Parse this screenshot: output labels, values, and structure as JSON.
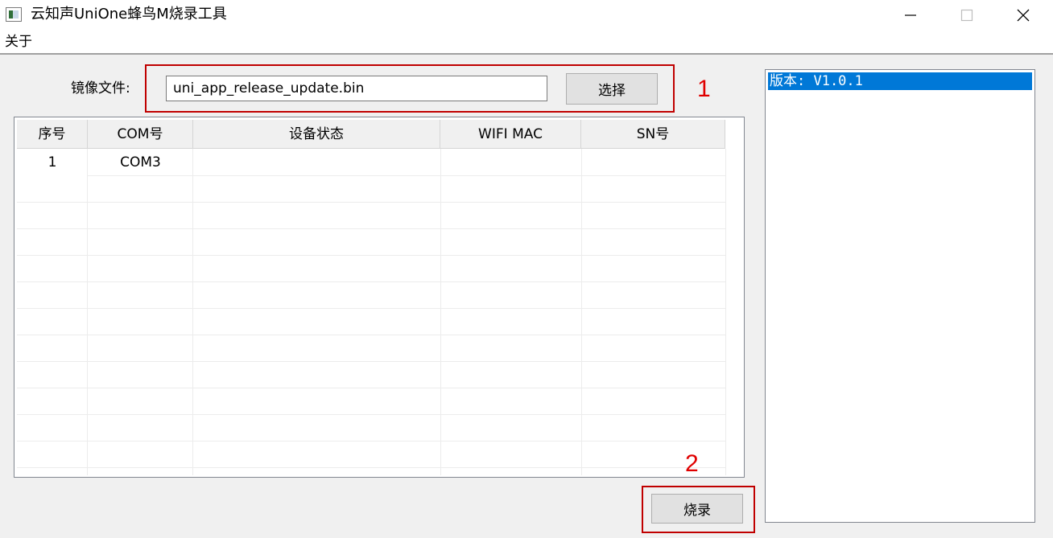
{
  "window": {
    "title": "云知声UniOne蜂鸟M烧录工具",
    "minimize_icon": "minimize-icon",
    "maximize_icon": "maximize-icon",
    "close_icon": "close-icon"
  },
  "menu": {
    "items": [
      {
        "label": "关于"
      }
    ]
  },
  "file": {
    "label": "镜像文件:",
    "value": "uni_app_release_update.bin",
    "select_label": "选择"
  },
  "table": {
    "columns": [
      "序号",
      "COM号",
      "设备状态",
      "WIFI MAC",
      "SN号"
    ],
    "rows": [
      {
        "index": "1",
        "com": "COM3",
        "status": "",
        "wifi_mac": "",
        "sn": ""
      }
    ]
  },
  "burn": {
    "label": "烧录"
  },
  "version": {
    "items": [
      "版本: V1.0.1"
    ]
  },
  "annotations": {
    "first": "1",
    "second": "2",
    "color": "#e00000"
  },
  "colors": {
    "selection": "#0078d7",
    "window_bg": "#f0f0f0"
  }
}
